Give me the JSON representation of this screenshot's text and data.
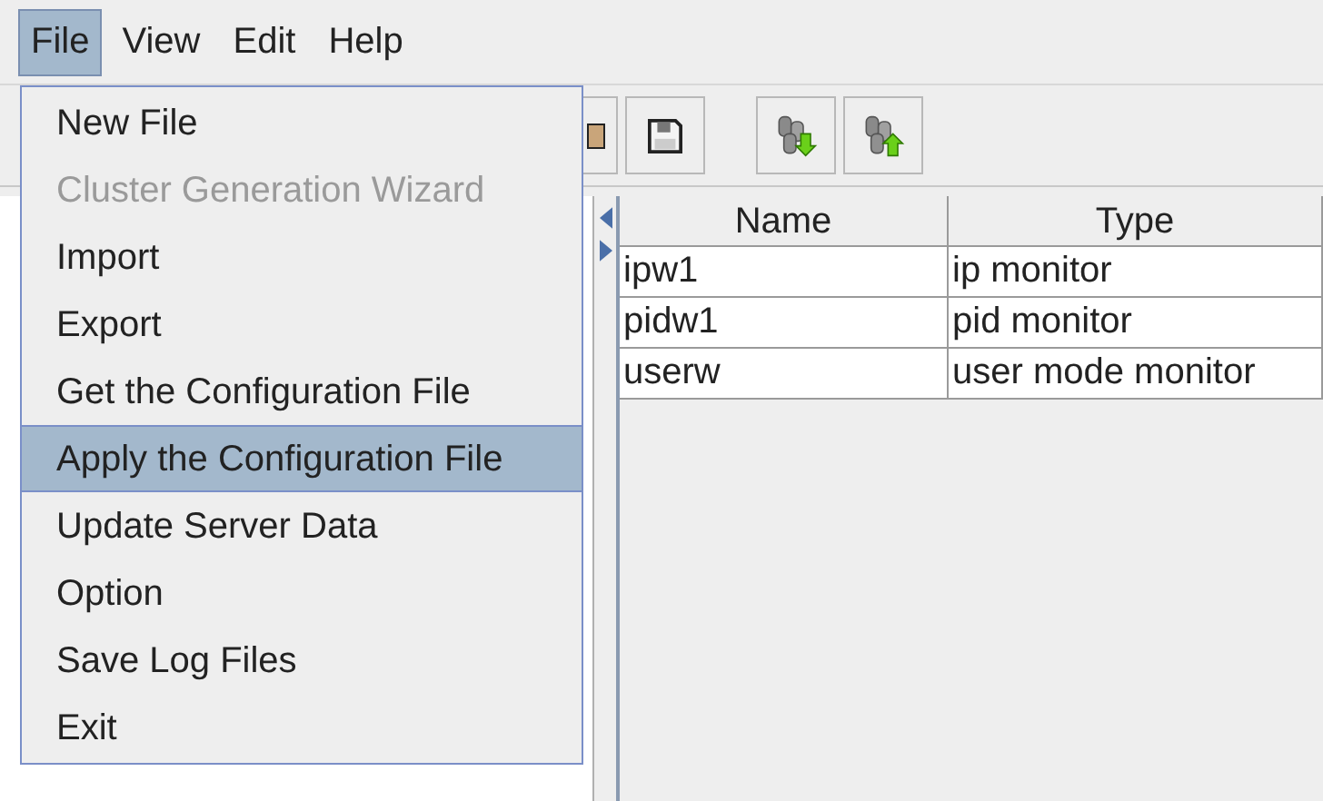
{
  "menu_bar": [
    {
      "label": "File",
      "selected": true
    },
    {
      "label": "View",
      "selected": false
    },
    {
      "label": "Edit",
      "selected": false
    },
    {
      "label": "Help",
      "selected": false
    }
  ],
  "file_menu": [
    {
      "label": "New File",
      "disabled": false,
      "selected": false
    },
    {
      "label": "Cluster Generation Wizard",
      "disabled": true,
      "selected": false
    },
    {
      "label": "Import",
      "disabled": false,
      "selected": false
    },
    {
      "label": "Export",
      "disabled": false,
      "selected": false
    },
    {
      "label": "Get the Configuration File",
      "disabled": false,
      "selected": false
    },
    {
      "label": "Apply the Configuration File",
      "disabled": false,
      "selected": true
    },
    {
      "label": "Update Server Data",
      "disabled": false,
      "selected": false
    },
    {
      "label": "Option",
      "disabled": false,
      "selected": false
    },
    {
      "label": "Save Log Files",
      "disabled": false,
      "selected": false
    },
    {
      "label": "Exit",
      "disabled": false,
      "selected": false
    }
  ],
  "table": {
    "columns": [
      "Name",
      "Type"
    ],
    "rows": [
      [
        "ipw1",
        "ip monitor"
      ],
      [
        "pidw1",
        "pid monitor"
      ],
      [
        "userw",
        "user mode monitor"
      ]
    ]
  }
}
